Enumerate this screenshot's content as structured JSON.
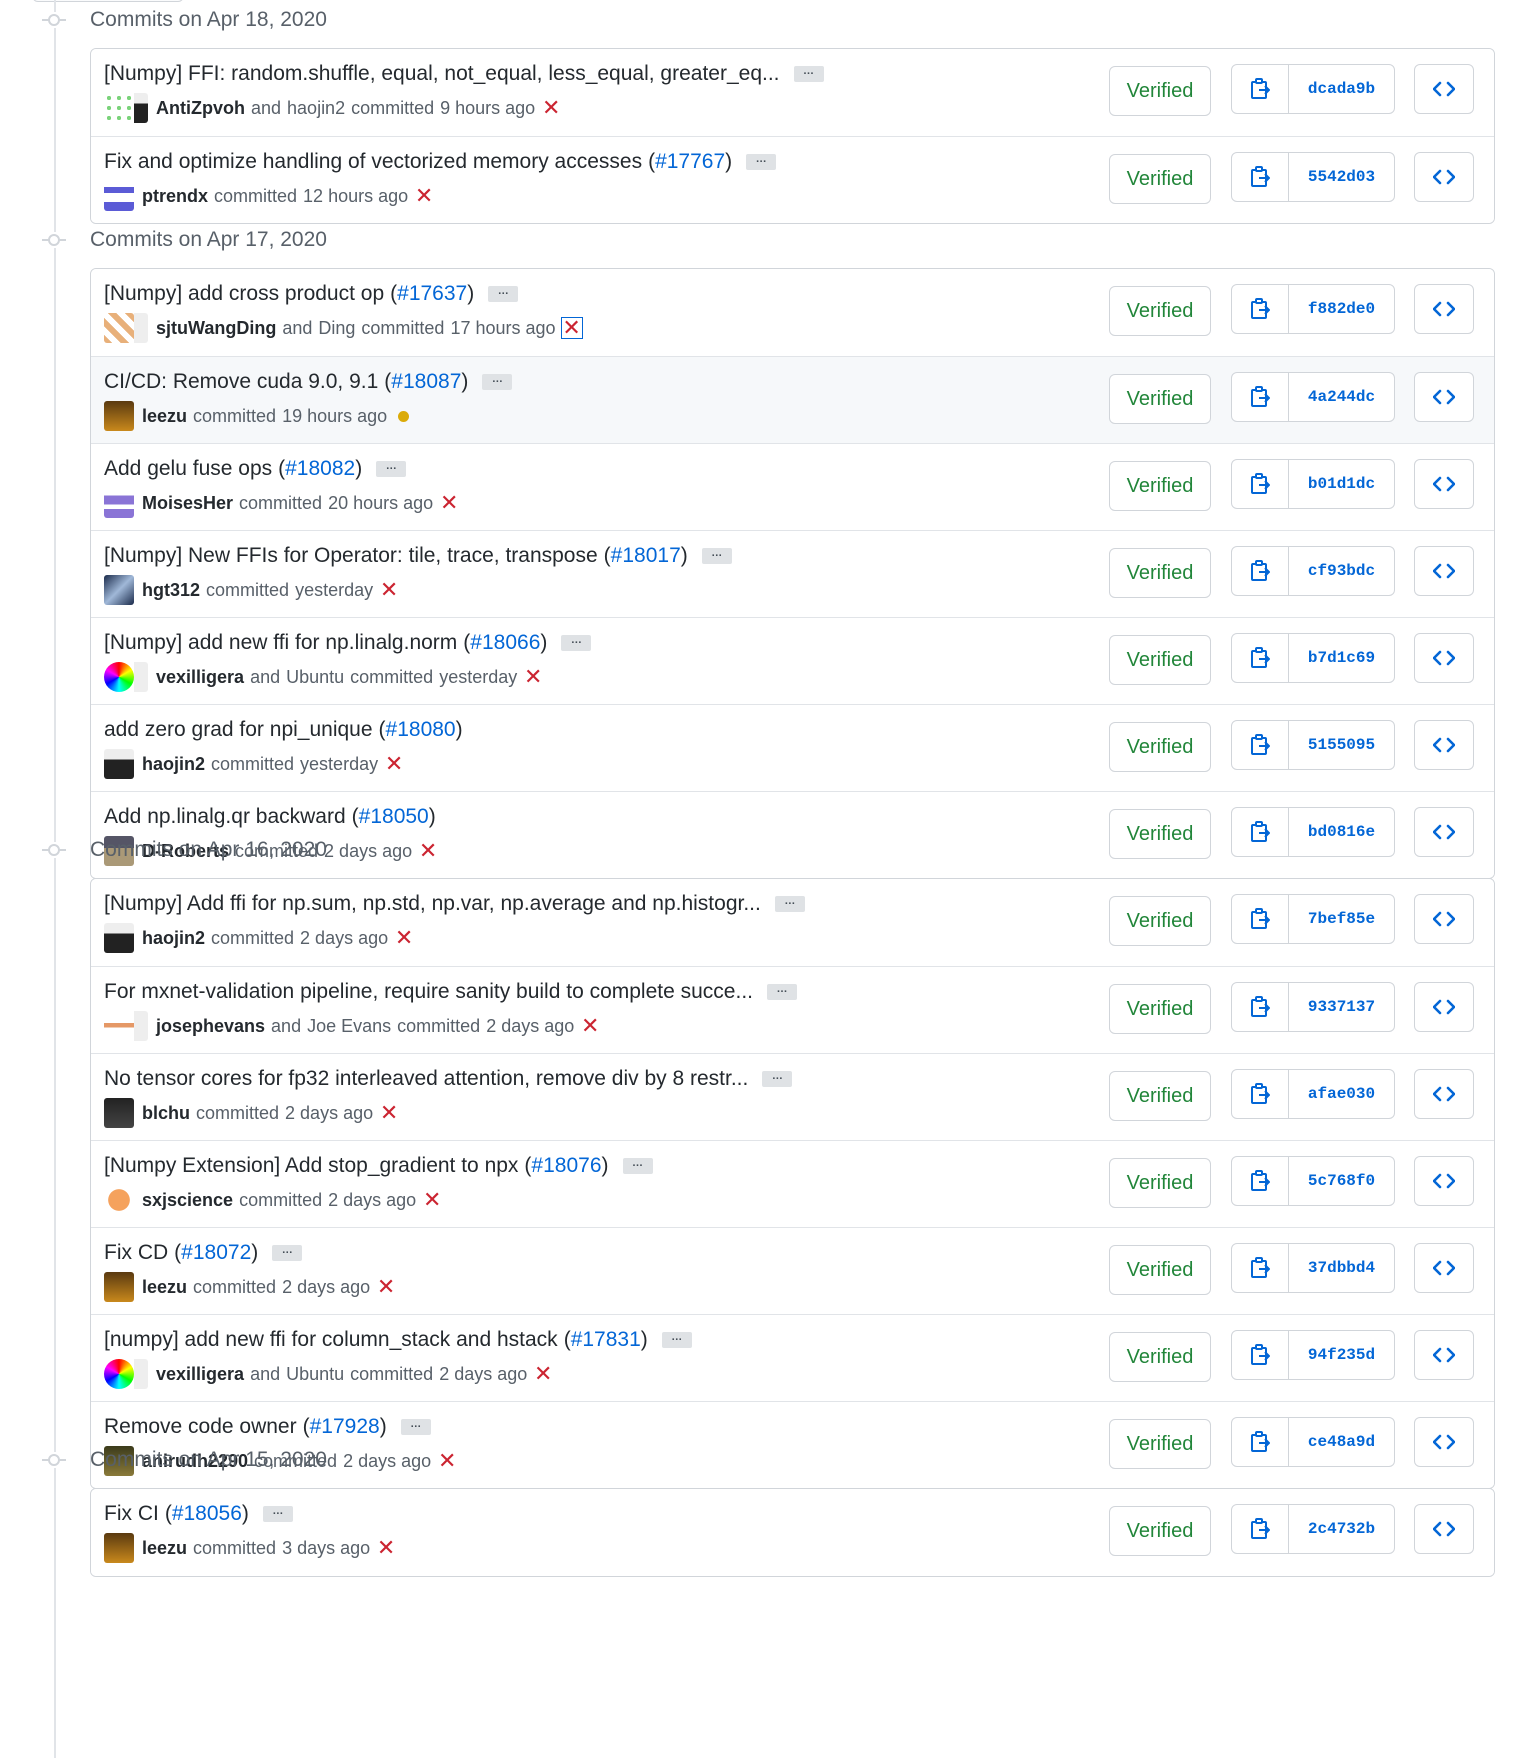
{
  "colors": {
    "accent": "#0366d6",
    "verified": "#22863a",
    "fail": "#cb2431",
    "pending": "#dbab09"
  },
  "labels": {
    "verified": "Verified",
    "ellipsis": "…",
    "committed": "committed",
    "and": "and"
  },
  "groups": [
    {
      "title": "Commits on Apr 18, 2020",
      "commits": [
        {
          "message": "[Numpy] FFI: random.shuffle, equal, not_equal, less_equal, greater_eq...",
          "pr": "",
          "authors": [
            "AntiZpvoh",
            "haojin2"
          ],
          "time": "9 hours ago",
          "status": "fail",
          "sha": "dcada9b",
          "ellipsis": true
        },
        {
          "message": "Fix and optimize handling of vectorized memory accesses",
          "pr": "#17767",
          "authors": [
            "ptrendx"
          ],
          "time": "12 hours ago",
          "status": "fail",
          "sha": "5542d03",
          "ellipsis": true
        }
      ]
    },
    {
      "title": "Commits on Apr 17, 2020",
      "commits": [
        {
          "message": "[Numpy] add cross product op",
          "pr": "#17637",
          "authors": [
            "sjtuWangDing",
            "Ding"
          ],
          "time": "17 hours ago",
          "status": "fail-boxed",
          "sha": "f882de0",
          "ellipsis": true
        },
        {
          "message": "CI/CD: Remove cuda 9.0, 9.1",
          "pr": "#18087",
          "authors": [
            "leezu"
          ],
          "time": "19 hours ago",
          "status": "pending",
          "sha": "4a244dc",
          "ellipsis": true,
          "highlight": true
        },
        {
          "message": "Add gelu fuse ops",
          "pr": "#18082",
          "authors": [
            "MoisesHer"
          ],
          "time": "20 hours ago",
          "status": "fail",
          "sha": "b01d1dc",
          "ellipsis": true
        },
        {
          "message": "[Numpy] New FFIs for Operator: tile, trace, transpose",
          "pr": "#18017",
          "authors": [
            "hgt312"
          ],
          "time": "yesterday",
          "status": "fail",
          "sha": "cf93bdc",
          "ellipsis": true
        },
        {
          "message": "[Numpy] add new ffi for np.linalg.norm",
          "pr": "#18066",
          "authors": [
            "vexilligera",
            "Ubuntu"
          ],
          "time": "yesterday",
          "status": "fail",
          "sha": "b7d1c69",
          "ellipsis": true
        },
        {
          "message": "add zero grad for npi_unique",
          "pr": "#18080",
          "authors": [
            "haojin2"
          ],
          "time": "yesterday",
          "status": "fail",
          "sha": "5155095",
          "ellipsis": false
        },
        {
          "message": "Add np.linalg.qr backward",
          "pr": "#18050",
          "authors": [
            "D-Roberts"
          ],
          "time": "2 days ago",
          "status": "fail",
          "sha": "bd0816e",
          "ellipsis": false
        }
      ]
    },
    {
      "title": "Commits on Apr 16, 2020",
      "commits": [
        {
          "message": "[Numpy] Add ffi for np.sum, np.std, np.var, np.average and np.histogr...",
          "pr": "",
          "authors": [
            "haojin2"
          ],
          "time": "2 days ago",
          "status": "fail",
          "sha": "7bef85e",
          "ellipsis": true
        },
        {
          "message": "For mxnet-validation pipeline, require sanity build to complete succe...",
          "pr": "",
          "authors": [
            "josephevans",
            "Joe Evans"
          ],
          "time": "2 days ago",
          "status": "fail",
          "sha": "9337137",
          "ellipsis": true
        },
        {
          "message": "No tensor cores for fp32 interleaved attention, remove div by 8 restr...",
          "pr": "",
          "authors": [
            "blchu"
          ],
          "time": "2 days ago",
          "status": "fail",
          "sha": "afae030",
          "ellipsis": true
        },
        {
          "message": "[Numpy Extension] Add stop_gradient to npx",
          "pr": "#18076",
          "authors": [
            "sxjscience"
          ],
          "time": "2 days ago",
          "status": "fail",
          "sha": "5c768f0",
          "ellipsis": true
        },
        {
          "message": "Fix CD",
          "pr": "#18072",
          "authors": [
            "leezu"
          ],
          "time": "2 days ago",
          "status": "fail",
          "sha": "37dbbd4",
          "ellipsis": true
        },
        {
          "message": "[numpy] add new ffi for column_stack and hstack",
          "pr": "#17831",
          "authors": [
            "vexilligera",
            "Ubuntu"
          ],
          "time": "2 days ago",
          "status": "fail",
          "sha": "94f235d",
          "ellipsis": true
        },
        {
          "message": "Remove code owner",
          "pr": "#17928",
          "authors": [
            "anirudh2290"
          ],
          "time": "2 days ago",
          "status": "fail",
          "sha": "ce48a9d",
          "ellipsis": true
        }
      ]
    },
    {
      "title": "Commits on Apr 15, 2020",
      "commits": [
        {
          "message": "Fix CI",
          "pr": "#18056",
          "authors": [
            "leezu"
          ],
          "time": "3 days ago",
          "status": "fail",
          "sha": "2c4732b",
          "ellipsis": true
        }
      ]
    }
  ]
}
